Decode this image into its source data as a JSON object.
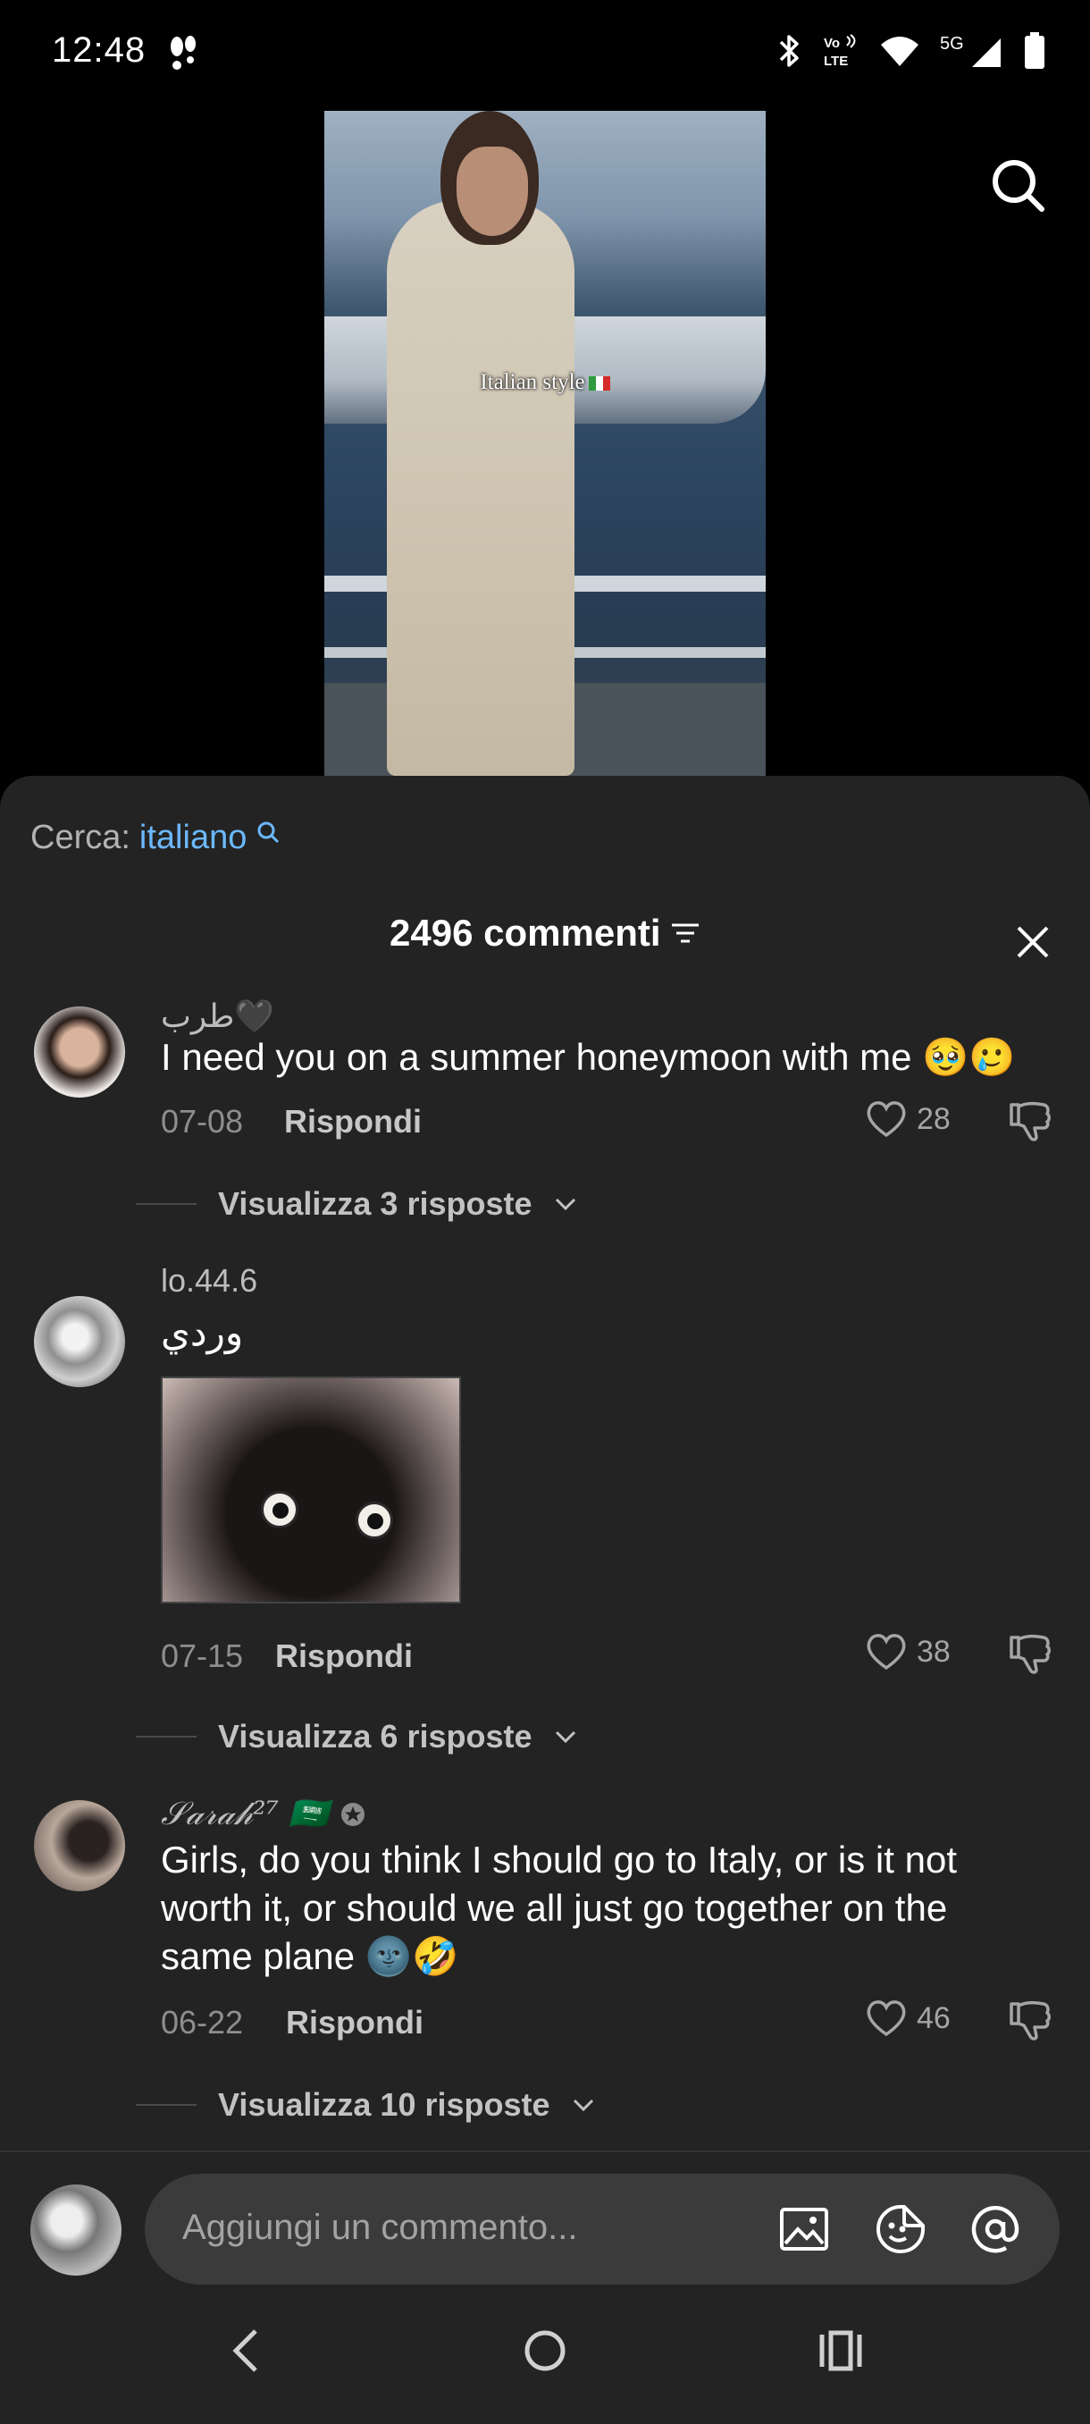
{
  "status": {
    "time": "12:48",
    "network": "5G",
    "volte": "Vo LTE"
  },
  "video": {
    "caption": "Italian style"
  },
  "search_hint": {
    "label": "Cerca:",
    "query": "italiano"
  },
  "header": {
    "title": "2496 commenti"
  },
  "comments": [
    {
      "username": "طرب🖤",
      "text": "I need you on a summer honeymoon with me 🥹🥲",
      "date": "07-08",
      "reply_label": "Rispondi",
      "likes": "28",
      "view_replies": "Visualizza 3 risposte"
    },
    {
      "username": "lo.44.6",
      "text": "وردي",
      "date": "07-15",
      "reply_label": "Rispondi",
      "likes": "38",
      "view_replies": "Visualizza 6 risposte"
    },
    {
      "username": "𝒮𝒶𝓇𝒶𝒽²⁷ 🇸🇦",
      "text": "Girls, do you think I should go to Italy, or is it not worth it, or should we all just go together on the same plane 🌚🤣",
      "date": "06-22",
      "reply_label": "Rispondi",
      "likes": "46",
      "view_replies": "Visualizza 10 risposte"
    }
  ],
  "composer": {
    "placeholder": "Aggiungi un commento..."
  },
  "colors": {
    "sheet_bg": "#232323",
    "accent": "#6cb8ff",
    "input_bg": "#3b3b3b"
  }
}
